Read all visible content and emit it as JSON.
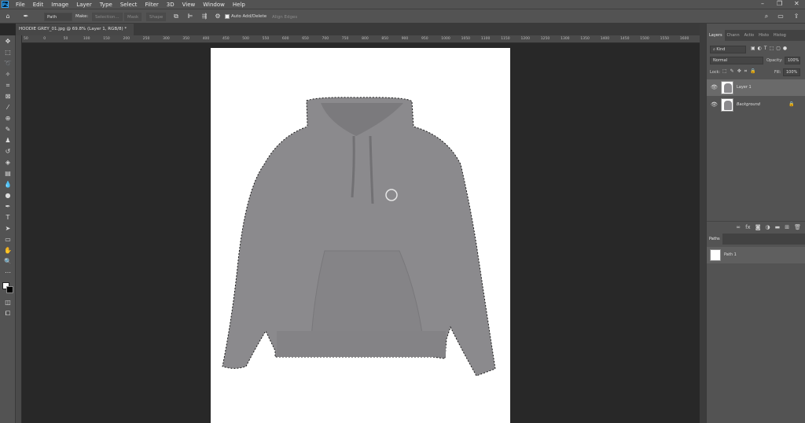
{
  "menubar": {
    "logo": "Ps",
    "items": [
      "File",
      "Edit",
      "Image",
      "Layer",
      "Type",
      "Select",
      "Filter",
      "3D",
      "View",
      "Window",
      "Help"
    ],
    "window_controls": [
      "–",
      "❐",
      "✕"
    ]
  },
  "options": {
    "mode_value": "Path",
    "make_label": "Make:",
    "selection_label": "Selection...",
    "mask_label": "Mask",
    "shape_label": "Shape",
    "auto_add_delete_label": "Auto Add/Delete",
    "align_edges_label": "Align Edges"
  },
  "document": {
    "tab_title": "HOODIE GREY_01.jpg @ 69.8% (Layer 1, RGB/8) *",
    "tab_close": "×"
  },
  "ruler_h_ticks": [
    "50",
    "0",
    "50",
    "100",
    "150",
    "200",
    "250",
    "300",
    "350",
    "400",
    "450",
    "500",
    "550",
    "600",
    "650",
    "700",
    "750",
    "800",
    "850",
    "900",
    "950",
    "1000",
    "1050",
    "1100",
    "1150",
    "1200",
    "1250",
    "1300",
    "1350",
    "1400",
    "1450",
    "1500",
    "1550",
    "1600"
  ],
  "layers_panel": {
    "tabs": [
      "Layers",
      "Chann",
      "Actio",
      "Histo",
      "Histog"
    ],
    "kind_label": "Kind",
    "blend_mode": "Normal",
    "opacity_label": "Opacity:",
    "opacity_value": "100%",
    "lock_label": "Lock:",
    "fill_label": "Fill:",
    "fill_value": "100%",
    "layers": [
      {
        "name": "Layer 1",
        "selected": true
      },
      {
        "name": "Background",
        "selected": false
      }
    ],
    "bottom_icons": [
      "link-icon",
      "fx-icon",
      "mask-icon",
      "adjustment-icon",
      "group-icon",
      "new-layer-icon",
      "trash-icon"
    ]
  },
  "paths_panel": {
    "tab": "Paths",
    "paths": [
      {
        "name": "Path 1"
      }
    ]
  },
  "colors": {
    "ui_bg": "#535353",
    "canvas_bg": "#282828",
    "hoodie": "#8b8a8d",
    "accent": "#31a8ff"
  }
}
